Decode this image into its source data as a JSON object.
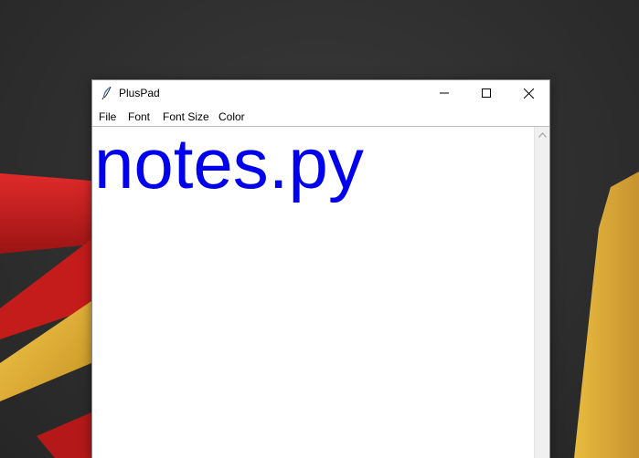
{
  "window": {
    "title": "PlusPad",
    "icon": "feather-icon"
  },
  "menu": {
    "items": [
      "File",
      "Font",
      "Font Size",
      "Color"
    ]
  },
  "editor": {
    "text": "notes.py",
    "text_color": "#0000ee"
  },
  "colors": {
    "desktop_bg": "#333333",
    "window_bg": "#ffffff",
    "red_shape": "#d51f1f",
    "yellow_shape": "#e3b53a"
  }
}
